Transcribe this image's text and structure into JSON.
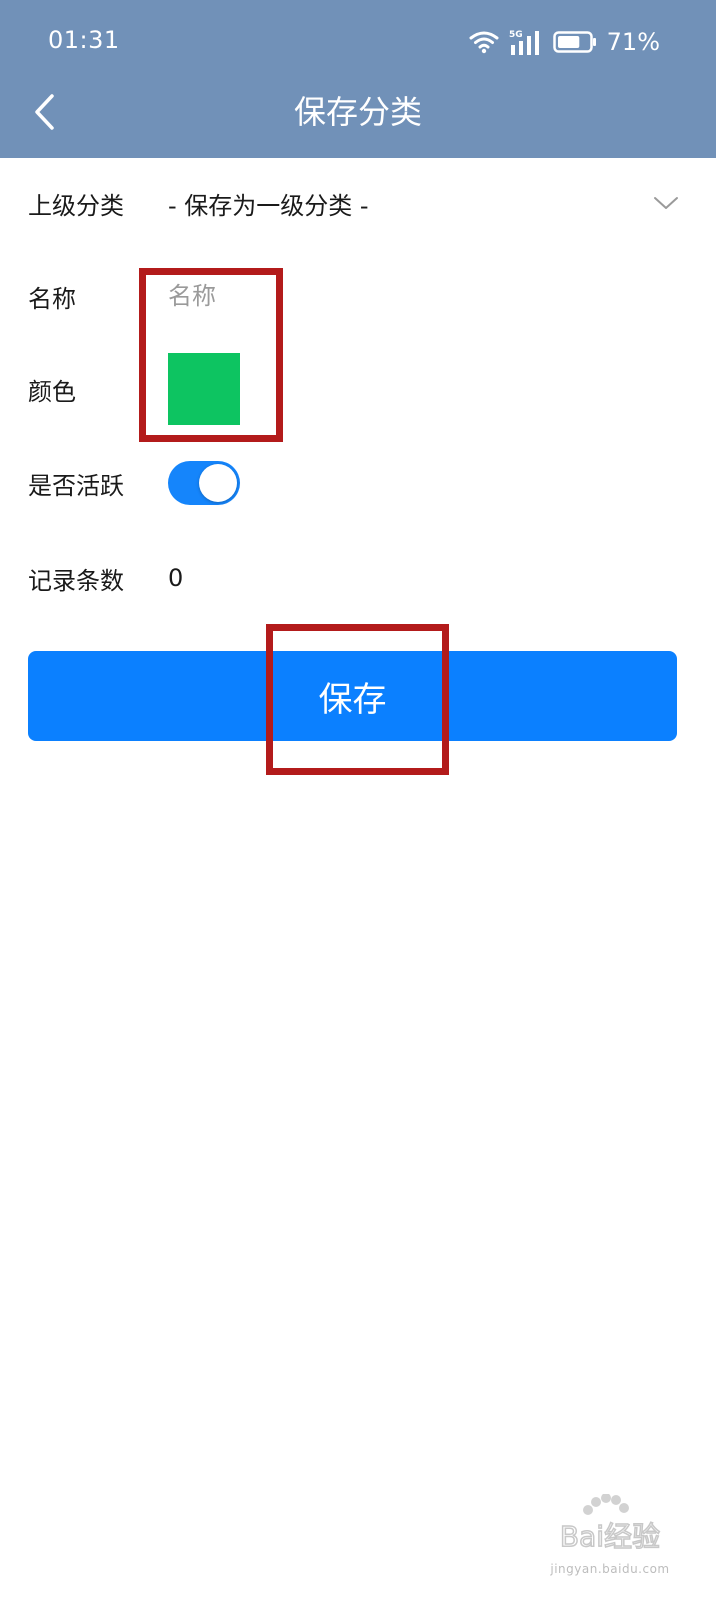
{
  "status_bar": {
    "time": "01:31",
    "network": "5G",
    "battery_percent": "71%",
    "battery_level": 0.71
  },
  "header": {
    "title": "保存分类",
    "back_icon": "chevron-left-icon",
    "background_color": "#7191b8"
  },
  "form": {
    "parent_category": {
      "label": "上级分类",
      "value": "- 保存为一级分类 -",
      "icon": "chevron-down-icon"
    },
    "name": {
      "label": "名称",
      "value": "",
      "placeholder": "名称"
    },
    "color": {
      "label": "颜色",
      "value": "#0dc461"
    },
    "active": {
      "label": "是否活跃",
      "checked": true,
      "on_color": "#1585fb"
    },
    "record_count": {
      "label": "记录条数",
      "value": "0"
    }
  },
  "save_button": {
    "label": "保存",
    "color": "#0b80ff"
  },
  "annotations": {
    "highlight_color": "#b31b1b"
  },
  "watermark": {
    "logo": "Bai经验",
    "url": "jingyan.baidu.com"
  }
}
